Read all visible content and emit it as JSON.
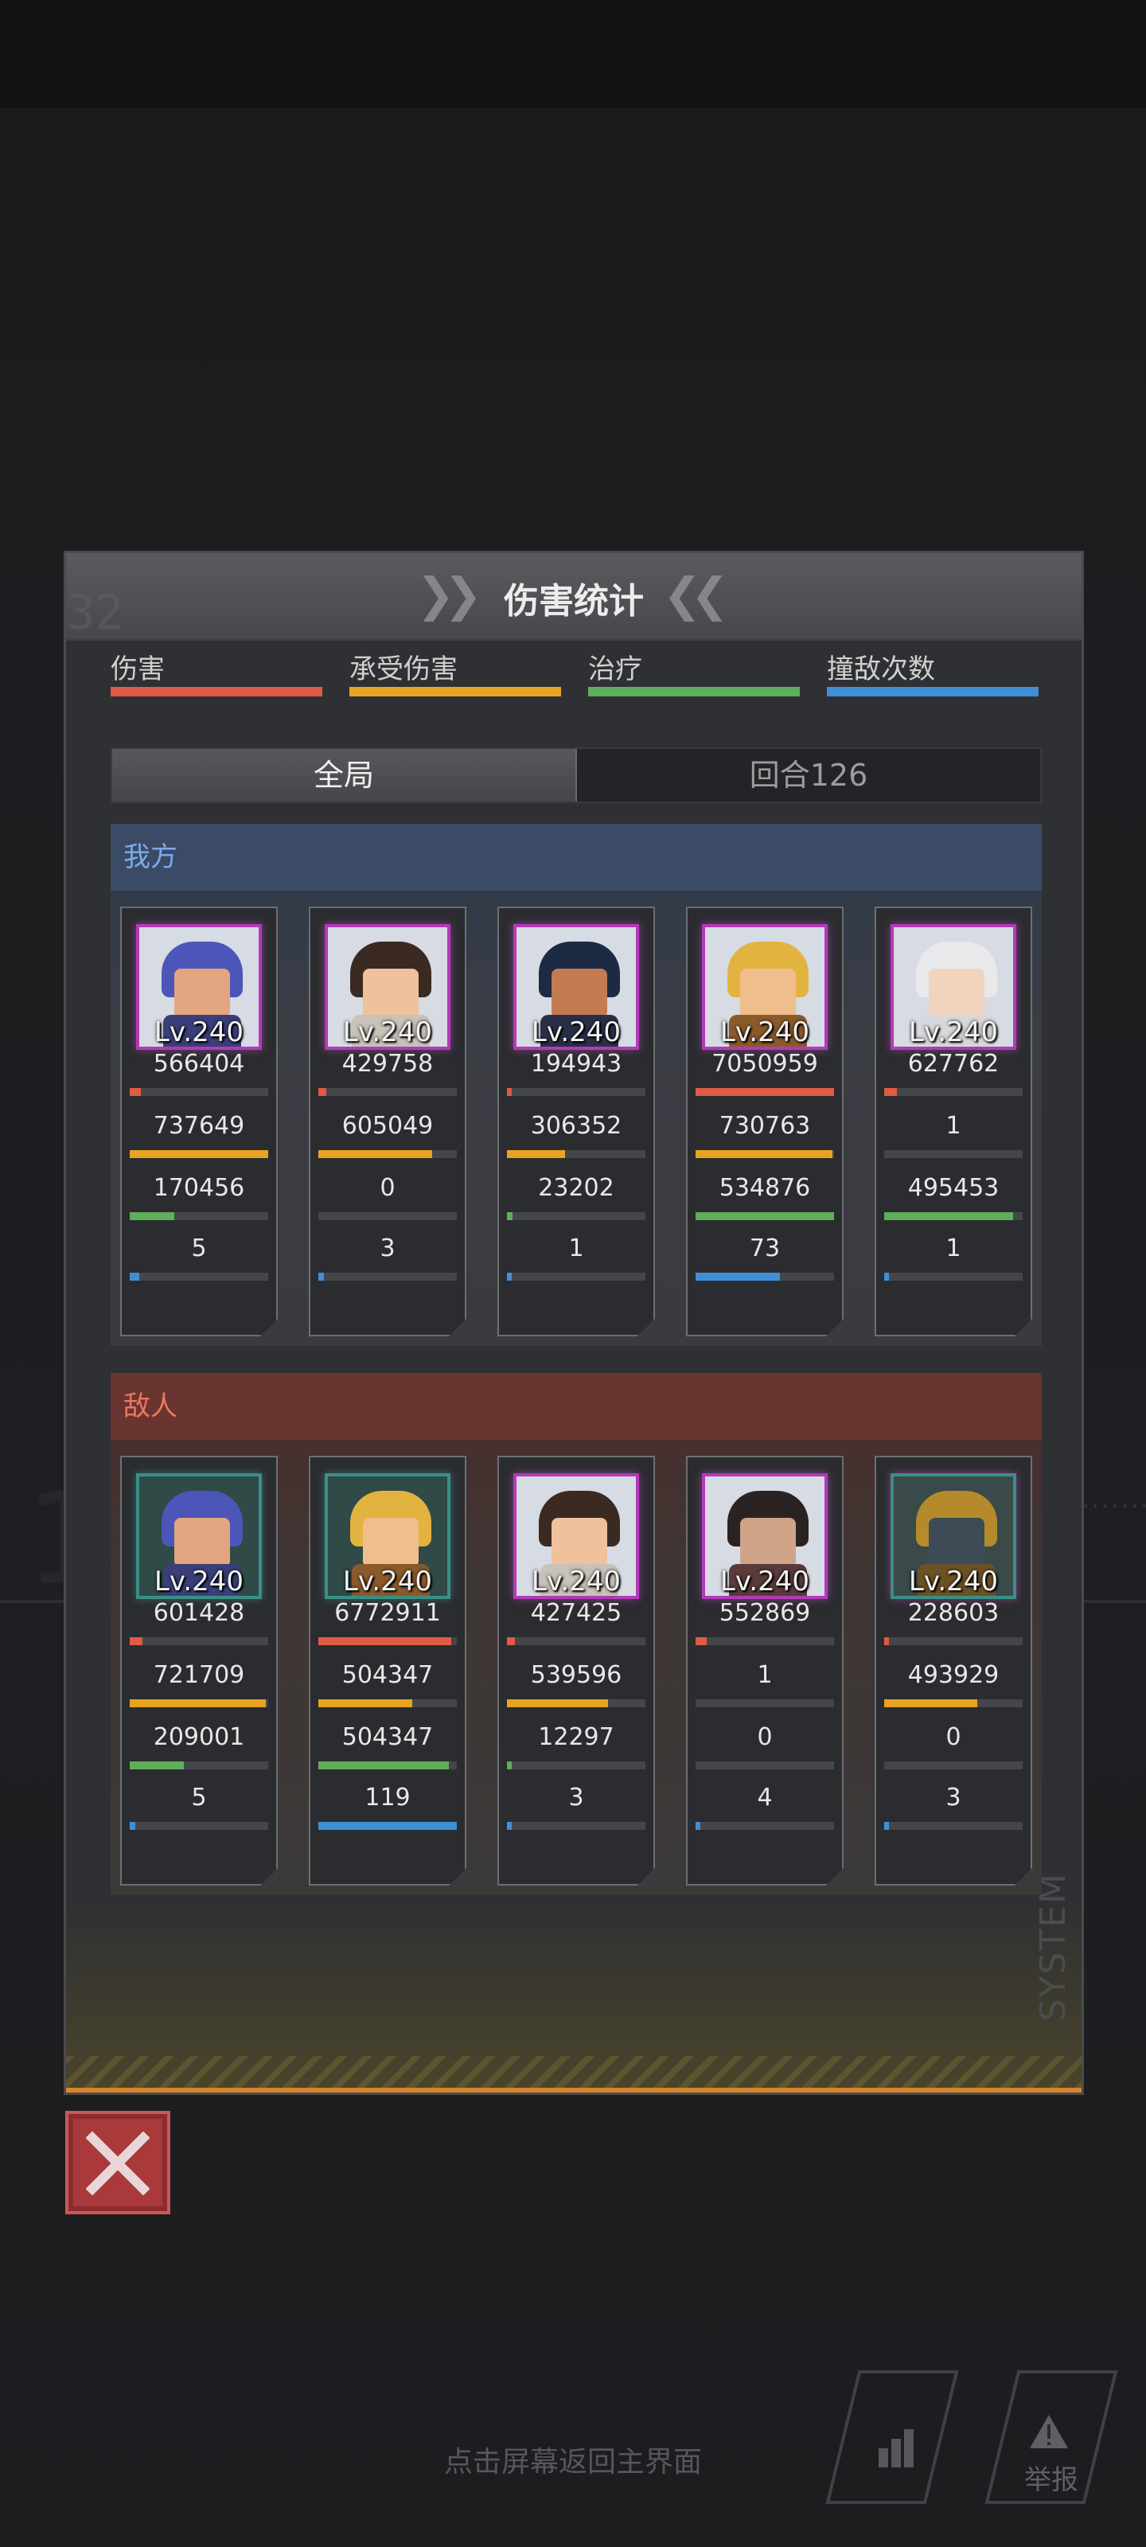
{
  "panel": {
    "title": "伤害统计",
    "header_deco": "32",
    "system_text": "SYSTEM"
  },
  "legend": [
    {
      "label": "伤害",
      "color": "#e05a45"
    },
    {
      "label": "承受伤害",
      "color": "#e9a323"
    },
    {
      "label": "治疗",
      "color": "#5fae5b"
    },
    {
      "label": "撞敌次数",
      "color": "#3f8fd8"
    }
  ],
  "tabs": {
    "overall": "全局",
    "round": "回合126"
  },
  "allies": {
    "label": "我方",
    "units": [
      {
        "level": "Lv.240",
        "damage": "566404",
        "damage_ratio": 0.08,
        "taken": "737649",
        "taken_ratio": 1.0,
        "heal": "170456",
        "heal_ratio": 0.32,
        "hits": "5",
        "hits_ratio": 0.07
      },
      {
        "level": "Lv.240",
        "damage": "429758",
        "damage_ratio": 0.06,
        "taken": "605049",
        "taken_ratio": 0.82,
        "heal": "0",
        "heal_ratio": 0,
        "hits": "3",
        "hits_ratio": 0.04
      },
      {
        "level": "Lv.240",
        "damage": "194943",
        "damage_ratio": 0.03,
        "taken": "306352",
        "taken_ratio": 0.42,
        "heal": "23202",
        "heal_ratio": 0.04,
        "hits": "1",
        "hits_ratio": 0.01
      },
      {
        "level": "Lv.240",
        "damage": "7050959",
        "damage_ratio": 1.0,
        "taken": "730763",
        "taken_ratio": 0.99,
        "heal": "534876",
        "heal_ratio": 1.0,
        "hits": "73",
        "hits_ratio": 0.61
      },
      {
        "level": "Lv.240",
        "damage": "627762",
        "damage_ratio": 0.09,
        "taken": "1",
        "taken_ratio": 0,
        "heal": "495453",
        "heal_ratio": 0.93,
        "hits": "1",
        "hits_ratio": 0.01
      }
    ]
  },
  "enemies": {
    "label": "敌人",
    "units": [
      {
        "level": "Lv.240",
        "damage": "601428",
        "damage_ratio": 0.09,
        "taken": "721709",
        "taken_ratio": 0.98,
        "heal": "209001",
        "heal_ratio": 0.39,
        "hits": "5",
        "hits_ratio": 0.04
      },
      {
        "level": "Lv.240",
        "damage": "6772911",
        "damage_ratio": 0.96,
        "taken": "504347",
        "taken_ratio": 0.68,
        "heal": "504347",
        "heal_ratio": 0.94,
        "hits": "119",
        "hits_ratio": 1.0
      },
      {
        "level": "Lv.240",
        "damage": "427425",
        "damage_ratio": 0.06,
        "taken": "539596",
        "taken_ratio": 0.73,
        "heal": "12297",
        "heal_ratio": 0.02,
        "hits": "3",
        "hits_ratio": 0.03
      },
      {
        "level": "Lv.240",
        "damage": "552869",
        "damage_ratio": 0.08,
        "taken": "1",
        "taken_ratio": 0,
        "heal": "0",
        "heal_ratio": 0,
        "hits": "4",
        "hits_ratio": 0.03
      },
      {
        "level": "Lv.240",
        "damage": "228603",
        "damage_ratio": 0.03,
        "taken": "493929",
        "taken_ratio": 0.67,
        "heal": "0",
        "heal_ratio": 0,
        "hits": "3",
        "hits_ratio": 0.03
      }
    ]
  },
  "footer": {
    "hint": "点击屏幕返回主界面",
    "report_label": "举报"
  }
}
